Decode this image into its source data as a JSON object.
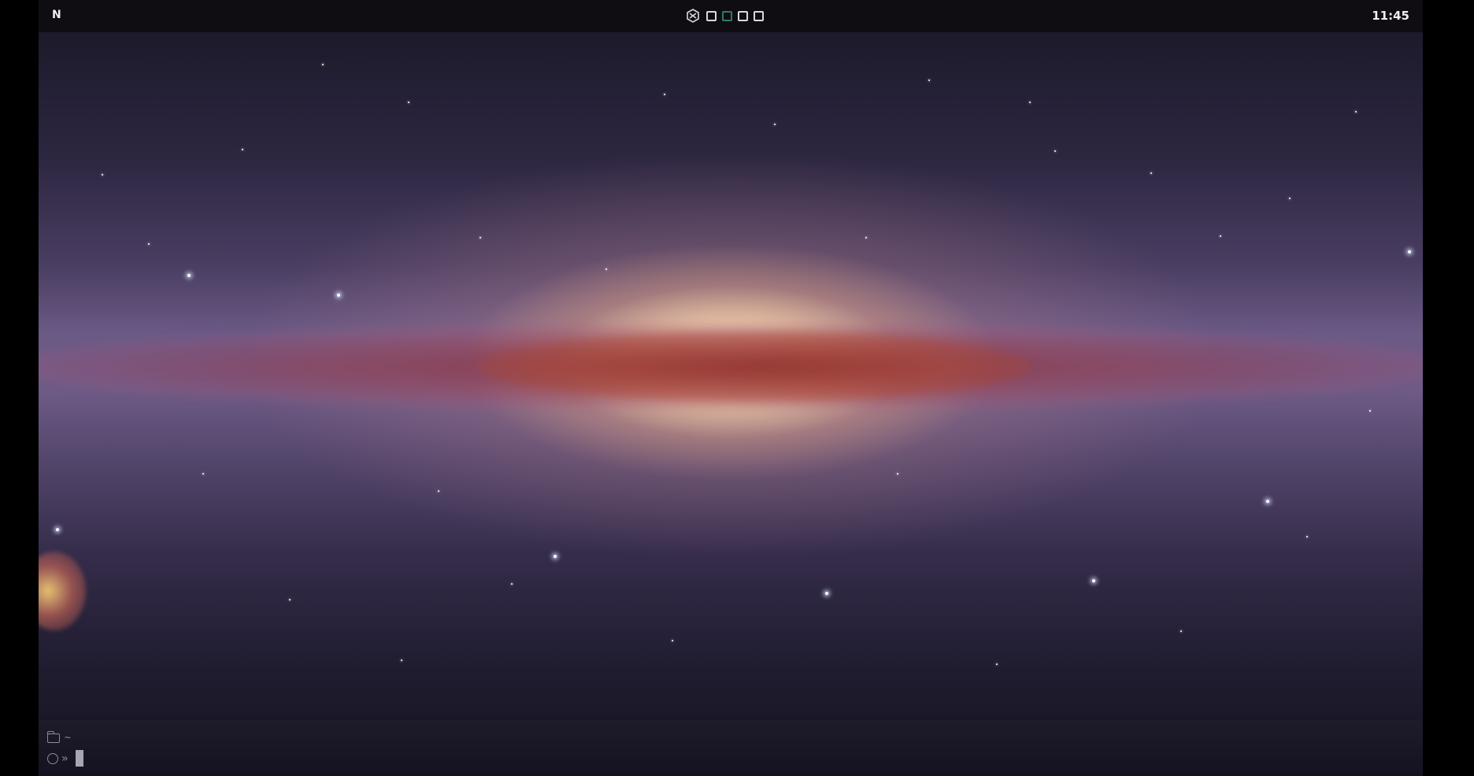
{
  "topbar": {
    "left_label": "N",
    "clock": "11:45",
    "workspaces": [
      {
        "name": "workspace-1",
        "active": false
      },
      {
        "name": "workspace-2",
        "active": true
      },
      {
        "name": "workspace-3",
        "active": false
      },
      {
        "name": "workspace-4",
        "active": false
      }
    ],
    "logo_icon": "nixos-logo-icon",
    "accent_color": "#2f7a6a"
  },
  "wallpaper": {
    "description_icon": "milky-way-wallpaper"
  },
  "terminal": {
    "cwd": "~",
    "prompt_symbol": "»",
    "folder_icon": "folder-icon",
    "status_icon": "circle-icon"
  }
}
